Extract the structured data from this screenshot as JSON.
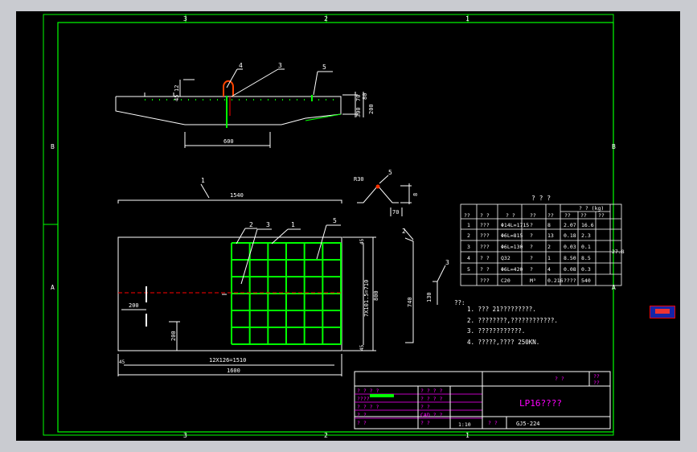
{
  "colors": {
    "background": "#000000",
    "frame": "#00ff00",
    "line": "#ffffff",
    "accent": "#ff0000",
    "text": "#ffffff",
    "magenta": "#ff00ff",
    "window": "#c9cbd0"
  },
  "border": {
    "top_numbers": [
      "3",
      "2",
      "1"
    ],
    "bottom_numbers": [
      "3",
      "2",
      "1"
    ],
    "left_letters": [
      "B",
      "A"
    ],
    "right_letters": [
      "B",
      "A"
    ]
  },
  "elevation": {
    "callouts": [
      "4",
      "3",
      "5"
    ],
    "dims": {
      "top_a": "12",
      "top_b": "45",
      "right_a": "300",
      "right_b": "70",
      "right_c": "80",
      "right_d": "200",
      "bottom": "600"
    }
  },
  "bar1": {
    "callout": "1",
    "length": "1540"
  },
  "bar5": {
    "callout": "5",
    "radius": "R30",
    "height": "8",
    "width": "70"
  },
  "bar2": {
    "callout": "2",
    "length": "740"
  },
  "bar3": {
    "callout": "3",
    "length": "130"
  },
  "plan": {
    "callouts": [
      "2",
      "3",
      "1",
      "5"
    ],
    "dims": {
      "left_200": "200",
      "bottom_200": "200",
      "grid_h": "12X126=1510",
      "total_w": "1600",
      "grid_v": "7X101.5=710",
      "total_h": "800",
      "edge_top": "45",
      "edge_bot": "45",
      "edge_left": "45"
    }
  },
  "table": {
    "title": "? ? ?",
    "headers": [
      "??",
      "?  ?",
      "?  ?",
      "??",
      "??",
      "?  ? (kg)",
      "??",
      "??",
      "??"
    ],
    "rows": [
      [
        "1",
        "???",
        "Φ14L=1715",
        "?",
        "8",
        "2.07",
        "16.6"
      ],
      [
        "2",
        "???",
        "Φ6L=815",
        "?",
        "13",
        "0.18",
        "2.3"
      ],
      [
        "3",
        "???",
        "Φ6L=130",
        "?",
        "2",
        "0.03",
        "0.1"
      ],
      [
        "4",
        "?  ?",
        "Q32",
        "?",
        "1",
        "8.50",
        "8.5"
      ],
      [
        "5",
        "?  ?",
        "Φ6L=420",
        "?",
        "4",
        "0.08",
        "0.3"
      ],
      [
        "",
        "???",
        "C20",
        "M³",
        "0.216",
        "????",
        "540"
      ]
    ],
    "merged_total": "27.8"
  },
  "notes": {
    "heading": "??:",
    "items": [
      "1. ???  21?????????.",
      "2. ????????,????????????.",
      "3. ????????????.",
      "4. ?????,????   250KN."
    ]
  },
  "title_block": {
    "top_right": "? ?",
    "top_far": "??\n??",
    "drawing_title": "LP16????",
    "left_cells": [
      "? ? ? ?",
      "????",
      "? ? ? ?",
      "?    ?",
      "?    ?"
    ],
    "mid_cells": [
      "? ? ? ?",
      "? ? ? ?",
      "?    ?",
      "CAD ? ?",
      "?    ?"
    ],
    "scale": "1:10",
    "code_label": "?    ?",
    "code": "GJ5-224"
  }
}
